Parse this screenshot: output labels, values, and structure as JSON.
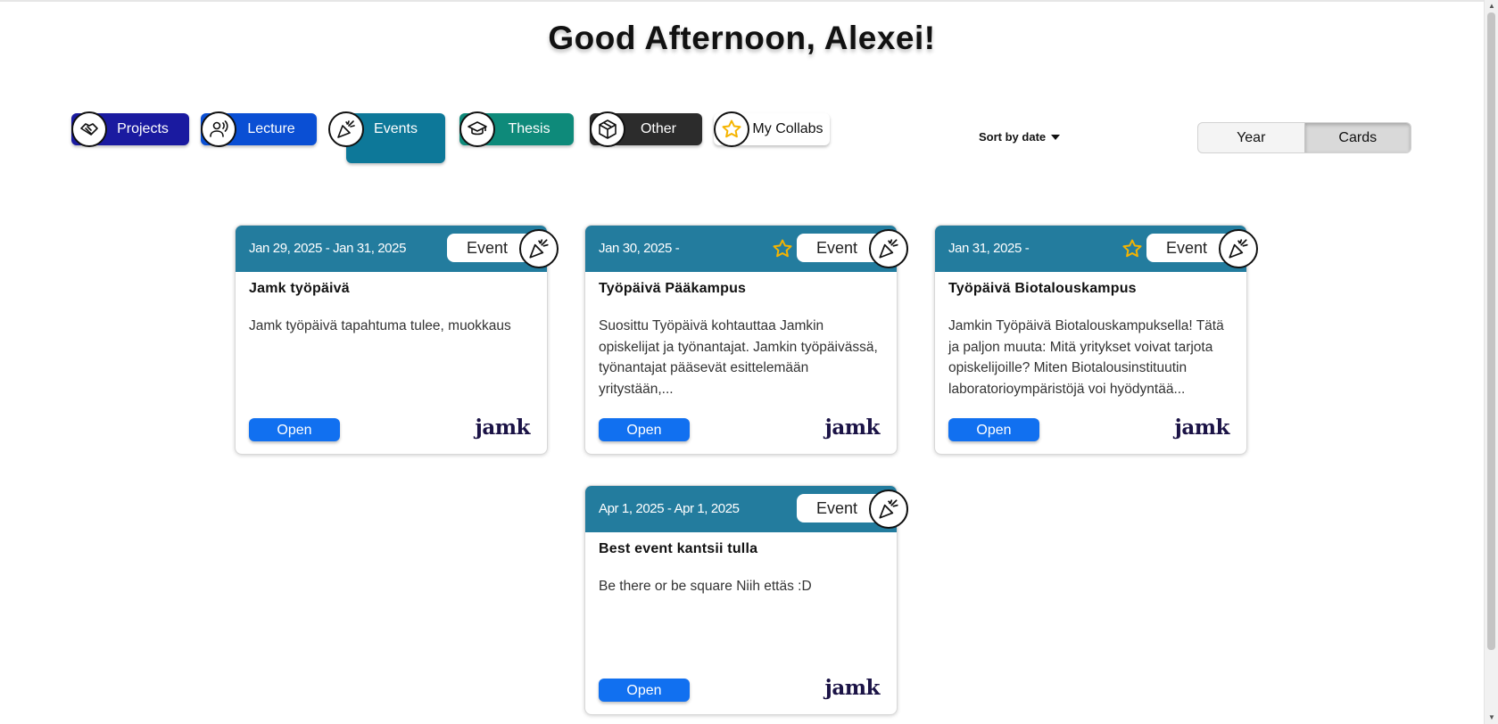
{
  "greeting": "Good Afternoon, Alexei!",
  "filters": [
    {
      "label": "Projects",
      "color": "#1a1aa0",
      "icon": "handshake-icon"
    },
    {
      "label": "Lecture",
      "color": "#0a4fd4",
      "icon": "speaker-icon"
    },
    {
      "label": "Events",
      "color": "#0d7899",
      "icon": "party-popper-icon"
    },
    {
      "label": "Thesis",
      "color": "#0e8a7a",
      "icon": "graduation-cap-icon"
    },
    {
      "label": "Other",
      "color": "#2c2c2c",
      "icon": "box-icon"
    },
    {
      "label": "My Collabs",
      "color": "#ffffff",
      "icon": "star-icon"
    }
  ],
  "sort": {
    "label": "Sort by date"
  },
  "view_toggle": {
    "options": [
      "Year",
      "Cards"
    ],
    "active": "Cards"
  },
  "colors": {
    "card_header": "#237c9e",
    "open_button": "#1170f0",
    "star": "#f5b400"
  },
  "cards": [
    {
      "date": "Jan 29, 2025 - Jan 31, 2025",
      "starred": false,
      "type": "Event",
      "title": "Jamk työpäivä",
      "description": "Jamk työpäivä tapahtuma tulee, muokkaus",
      "button": "Open",
      "logo": "jamk"
    },
    {
      "date": "Jan 30, 2025 -",
      "starred": true,
      "type": "Event",
      "title": "Työpäivä Pääkampus",
      "description": "Suosittu Työpäivä kohtauttaa Jamkin opiskelijat ja työnantajat. Jamkin työpäivässä, työnantajat pääsevät esittelemään yritystään,...",
      "button": "Open",
      "logo": "jamk"
    },
    {
      "date": "Jan 31, 2025 -",
      "starred": true,
      "type": "Event",
      "title": "Työpäivä Biotalouskampus",
      "description": "Jamkin Työpäivä Biotalouskampuksella! Tätä ja paljon muuta: Mitä yritykset voivat tarjota opiskelijoille? Miten Biotalousinstituutin laboratorioympäristöjä voi hyödyntää...",
      "button": "Open",
      "logo": "jamk"
    },
    {
      "date": "Apr 1, 2025 - Apr 1, 2025",
      "starred": false,
      "type": "Event",
      "title": "Best event kantsii tulla",
      "description": "Be there or be square Niih ettäs :D",
      "button": "Open",
      "logo": "jamk"
    }
  ]
}
